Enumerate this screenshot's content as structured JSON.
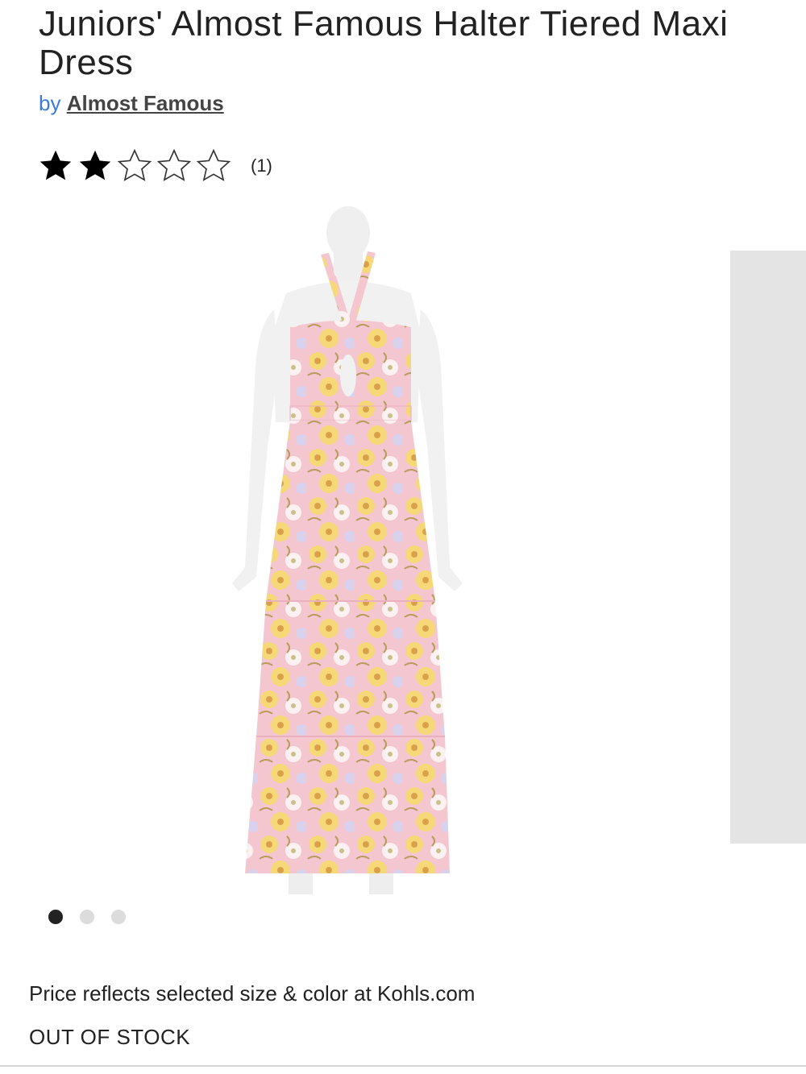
{
  "product": {
    "title": "Juniors' Almost Famous Halter Tiered Maxi Dress",
    "by_label": "by",
    "brand": "Almost Famous"
  },
  "rating": {
    "value": 2,
    "max": 5,
    "count_label": "(1)"
  },
  "gallery": {
    "image_count": 3,
    "active_index": 0
  },
  "pricing": {
    "note": "Price reflects selected size & color at Kohls.com"
  },
  "availability": {
    "status": "OUT OF STOCK"
  },
  "colors": {
    "link_blue": "#3a7bd5",
    "text": "#222222",
    "dress_pink": "#f4c6d0",
    "dress_yellow": "#f6d878"
  }
}
